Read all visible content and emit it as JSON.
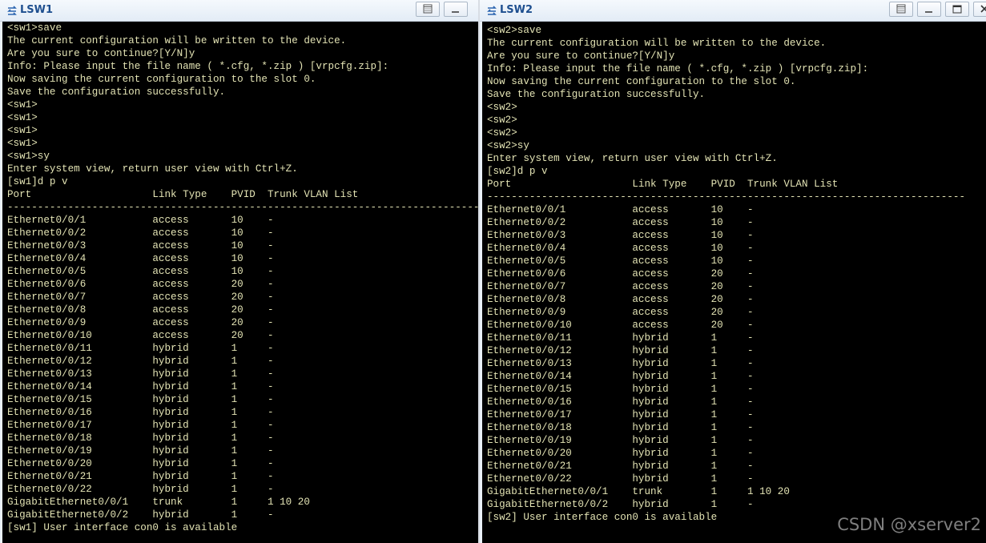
{
  "lsw1": {
    "title": "LSW1",
    "terminal_lines": [
      "<sw1>save",
      "The current configuration will be written to the device.",
      "Are you sure to continue?[Y/N]y",
      "Info: Please input the file name ( *.cfg, *.zip ) [vrpcfg.zip]:",
      "Now saving the current configuration to the slot 0.",
      "Save the configuration successfully.",
      "<sw1>",
      "<sw1>",
      "<sw1>",
      "<sw1>",
      "<sw1>sy",
      "Enter system view, return user view with Ctrl+Z.",
      "[sw1]d p v",
      "Port                    Link Type    PVID  Trunk VLAN List",
      "-------------------------------------------------------------------------------",
      "Ethernet0/0/1           access       10    -",
      "Ethernet0/0/2           access       10    -",
      "Ethernet0/0/3           access       10    -",
      "Ethernet0/0/4           access       10    -",
      "Ethernet0/0/5           access       10    -",
      "Ethernet0/0/6           access       20    -",
      "Ethernet0/0/7           access       20    -",
      "Ethernet0/0/8           access       20    -",
      "Ethernet0/0/9           access       20    -",
      "Ethernet0/0/10          access       20    -",
      "Ethernet0/0/11          hybrid       1     -",
      "Ethernet0/0/12          hybrid       1     -",
      "Ethernet0/0/13          hybrid       1     -",
      "Ethernet0/0/14          hybrid       1     -",
      "Ethernet0/0/15          hybrid       1     -",
      "Ethernet0/0/16          hybrid       1     -",
      "Ethernet0/0/17          hybrid       1     -",
      "Ethernet0/0/18          hybrid       1     -",
      "Ethernet0/0/19          hybrid       1     -",
      "Ethernet0/0/20          hybrid       1     -",
      "Ethernet0/0/21          hybrid       1     -",
      "Ethernet0/0/22          hybrid       1     -",
      "GigabitEthernet0/0/1    trunk        1     1 10 20",
      "GigabitEthernet0/0/2    hybrid       1     -",
      "[sw1] User interface con0 is available"
    ]
  },
  "lsw2": {
    "title": "LSW2",
    "terminal_lines": [
      "<sw2>save",
      "The current configuration will be written to the device.",
      "Are you sure to continue?[Y/N]y",
      "Info: Please input the file name ( *.cfg, *.zip ) [vrpcfg.zip]:",
      "Now saving the current configuration to the slot 0.",
      "Save the configuration successfully.",
      "<sw2>",
      "<sw2>",
      "<sw2>",
      "<sw2>sy",
      "Enter system view, return user view with Ctrl+Z.",
      "[sw2]d p v",
      "Port                    Link Type    PVID  Trunk VLAN List",
      "-------------------------------------------------------------------------------",
      "Ethernet0/0/1           access       10    -",
      "Ethernet0/0/2           access       10    -",
      "Ethernet0/0/3           access       10    -",
      "Ethernet0/0/4           access       10    -",
      "Ethernet0/0/5           access       10    -",
      "Ethernet0/0/6           access       20    -",
      "Ethernet0/0/7           access       20    -",
      "Ethernet0/0/8           access       20    -",
      "Ethernet0/0/9           access       20    -",
      "Ethernet0/0/10          access       20    -",
      "Ethernet0/0/11          hybrid       1     -",
      "Ethernet0/0/12          hybrid       1     -",
      "Ethernet0/0/13          hybrid       1     -",
      "Ethernet0/0/14          hybrid       1     -",
      "Ethernet0/0/15          hybrid       1     -",
      "Ethernet0/0/16          hybrid       1     -",
      "Ethernet0/0/17          hybrid       1     -",
      "Ethernet0/0/18          hybrid       1     -",
      "Ethernet0/0/19          hybrid       1     -",
      "Ethernet0/0/20          hybrid       1     -",
      "Ethernet0/0/21          hybrid       1     -",
      "Ethernet0/0/22          hybrid       1     -",
      "GigabitEthernet0/0/1    trunk        1     1 10 20",
      "GigabitEthernet0/0/2    hybrid       1     -",
      "[sw2] User interface con0 is available"
    ]
  },
  "watermark": "CSDN @xserver2",
  "icons": {
    "app": "switch-app-icon",
    "restore": "restore-icon",
    "minimize": "minimize-icon",
    "maximize": "maximize-icon",
    "close": "close-icon"
  },
  "colors": {
    "terminal_bg": "#000000",
    "terminal_text": "#e3e3b4",
    "title_text": "#1e4f8f",
    "watermark": "#7f7f7f"
  }
}
